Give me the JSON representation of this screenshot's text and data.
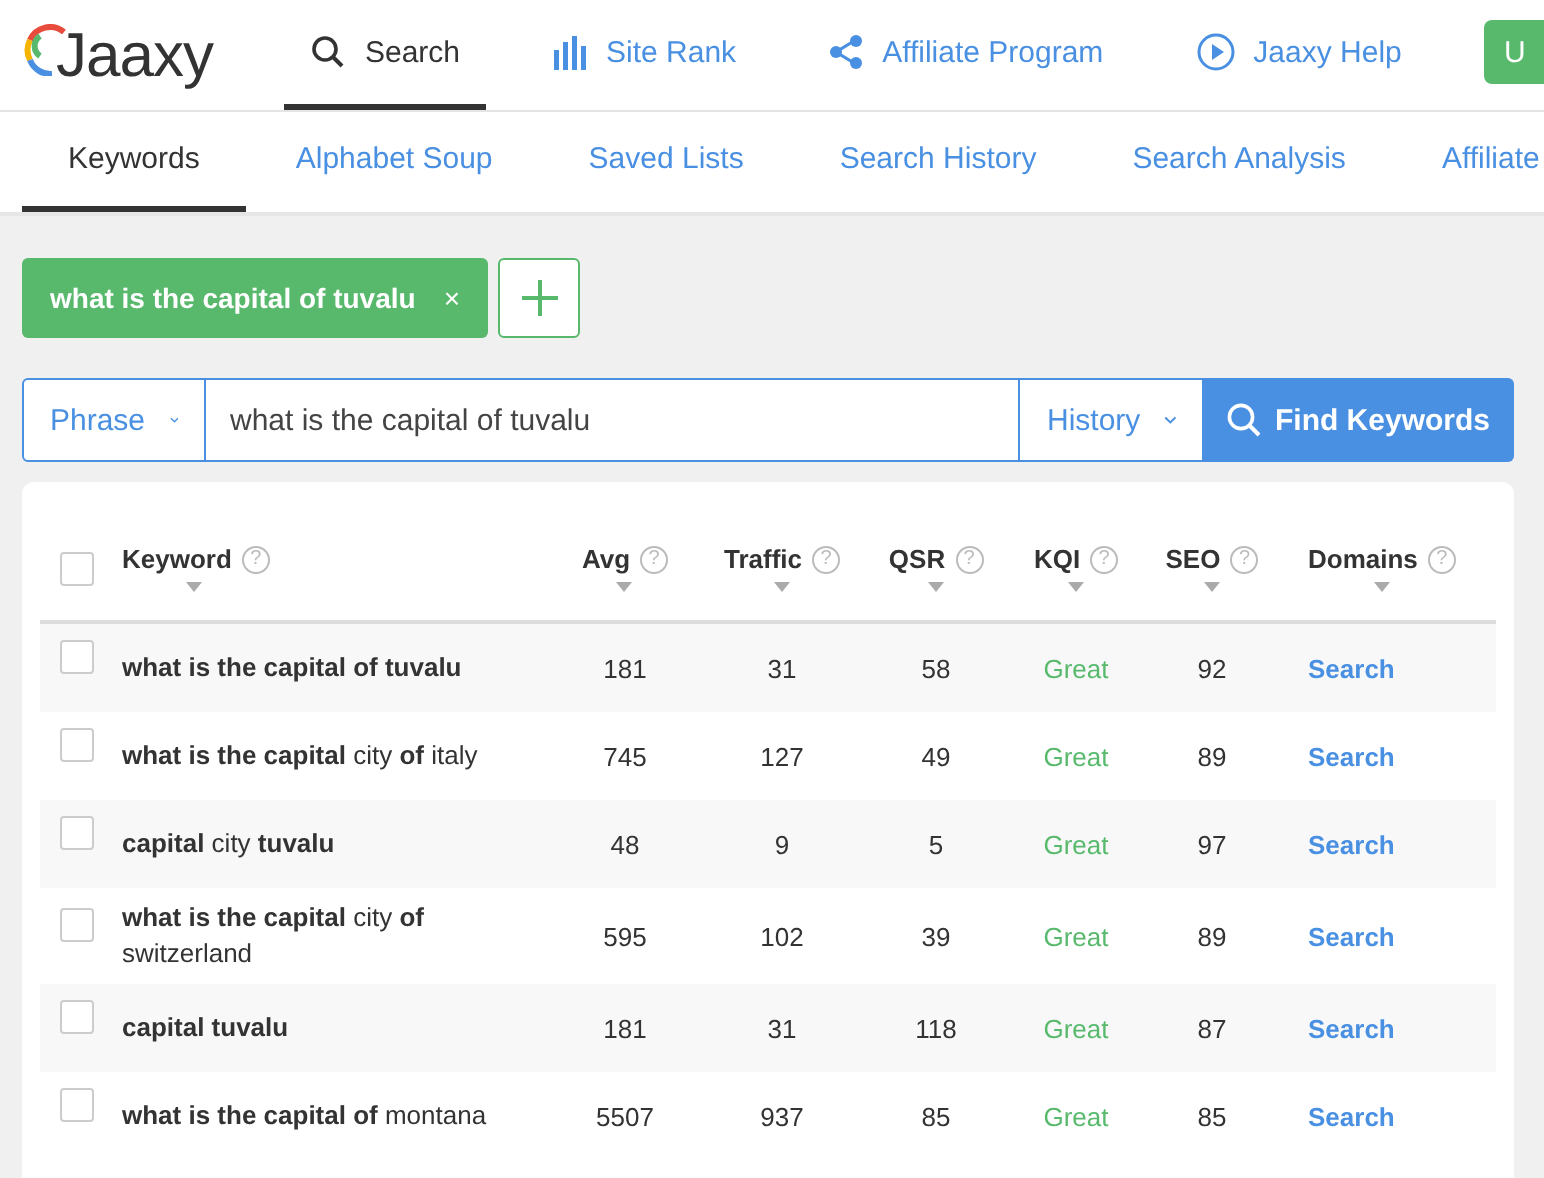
{
  "header": {
    "logo": "Jaaxy",
    "nav": [
      {
        "label": "Search",
        "selected": true
      },
      {
        "label": "Site Rank",
        "selected": false
      },
      {
        "label": "Affiliate Program",
        "selected": false
      },
      {
        "label": "Jaaxy Help",
        "selected": false
      }
    ],
    "cta": "U"
  },
  "tabs": [
    {
      "label": "Keywords",
      "selected": true
    },
    {
      "label": "Alphabet Soup",
      "selected": false
    },
    {
      "label": "Saved Lists",
      "selected": false
    },
    {
      "label": "Search History",
      "selected": false
    },
    {
      "label": "Search Analysis",
      "selected": false
    },
    {
      "label": "Affiliate",
      "selected": false
    }
  ],
  "search_tags": [
    {
      "label": "what is the capital of tuvalu",
      "remove": "×"
    }
  ],
  "search_bar": {
    "mode": "Phrase",
    "value": "what is the capital of tuvalu",
    "history": "History",
    "button": "Find Keywords"
  },
  "table": {
    "select_all": {
      "checked": false
    },
    "columns": [
      {
        "label": "Keyword",
        "help": "?"
      },
      {
        "label": "Avg",
        "help": "?"
      },
      {
        "label": "Traffic",
        "help": "?"
      },
      {
        "label": "QSR",
        "help": "?"
      },
      {
        "label": "KQI",
        "help": "?"
      },
      {
        "label": "SEO",
        "help": "?"
      },
      {
        "label": "Domains",
        "help": "?"
      }
    ],
    "rows": [
      {
        "checked": false,
        "keyword": "**what is the capital of tuvalu**",
        "avg": "181",
        "traffic": "31",
        "qsr": "58",
        "kqi": "Great",
        "seo": "92",
        "domains": "Search"
      },
      {
        "checked": false,
        "keyword": "**what is the capital** city **of** italy",
        "avg": "745",
        "traffic": "127",
        "qsr": "49",
        "kqi": "Great",
        "seo": "89",
        "domains": "Search"
      },
      {
        "checked": false,
        "keyword": "**capital** city **tuvalu**",
        "avg": "48",
        "traffic": "9",
        "qsr": "5",
        "kqi": "Great",
        "seo": "97",
        "domains": "Search"
      },
      {
        "checked": false,
        "keyword": "**what is the capital** city **of** switzerland",
        "avg": "595",
        "traffic": "102",
        "qsr": "39",
        "kqi": "Great",
        "seo": "89",
        "domains": "Search"
      },
      {
        "checked": false,
        "keyword": "**capital tuvalu**",
        "avg": "181",
        "traffic": "31",
        "qsr": "118",
        "kqi": "Great",
        "seo": "87",
        "domains": "Search"
      },
      {
        "checked": false,
        "keyword": "**what is the capital of** montana",
        "avg": "5507",
        "traffic": "937",
        "qsr": "85",
        "kqi": "Great",
        "seo": "85",
        "domains": "Search"
      }
    ]
  }
}
